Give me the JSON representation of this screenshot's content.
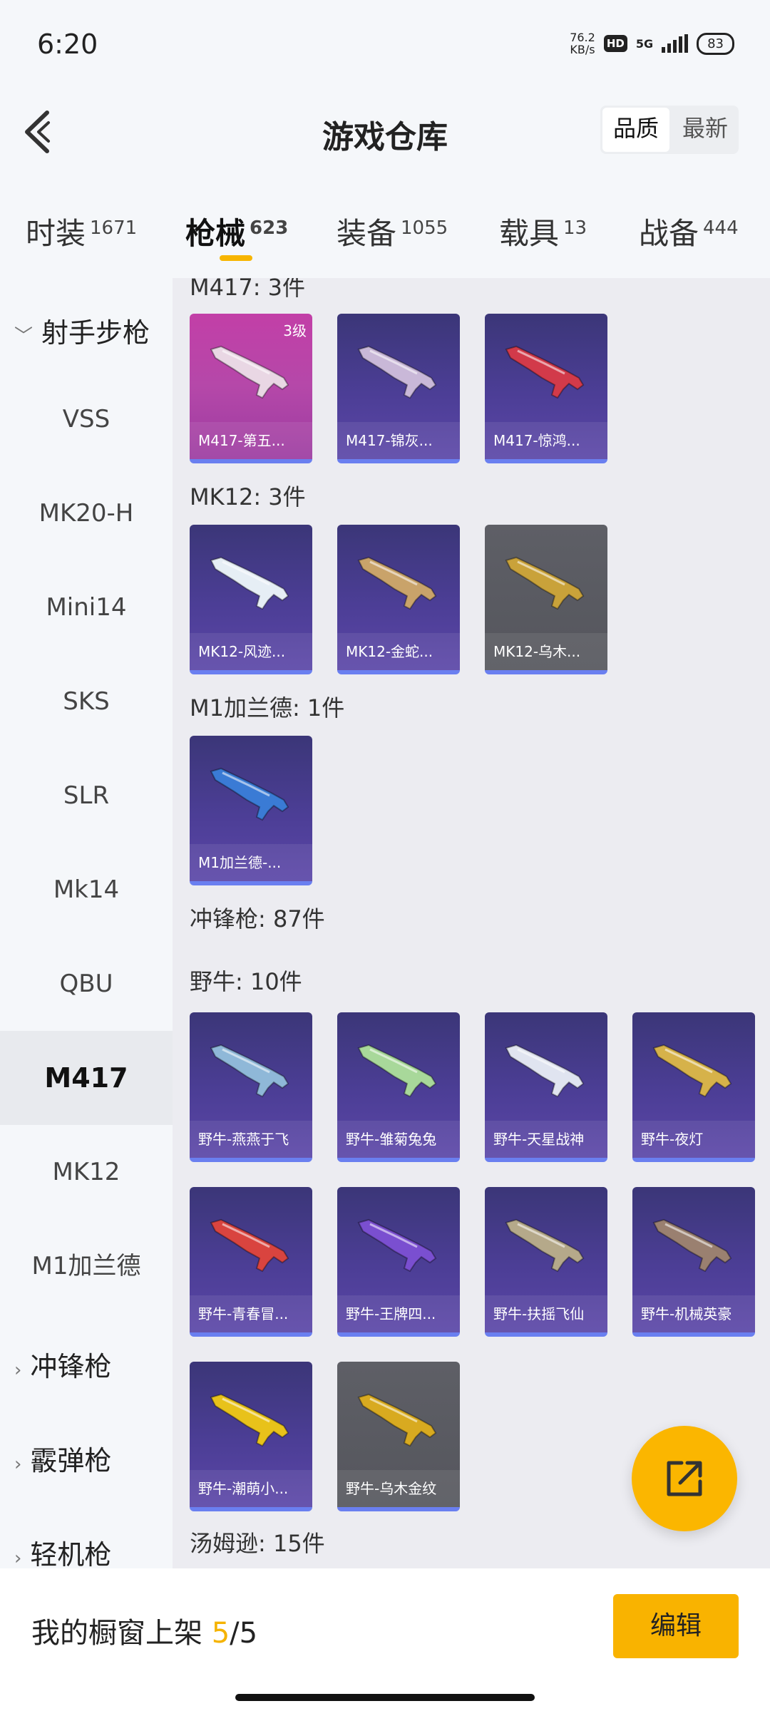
{
  "status": {
    "time": "6:20",
    "speed": "76.2",
    "speed_unit": "KB/s",
    "hd": "HD",
    "network": "5G",
    "battery": "83"
  },
  "header": {
    "title": "游戏仓库",
    "toggle": [
      "品质",
      "最新"
    ]
  },
  "tabs": [
    {
      "label": "时装",
      "count": "1671"
    },
    {
      "label": "枪械",
      "count": "623"
    },
    {
      "label": "装备",
      "count": "1055"
    },
    {
      "label": "载具",
      "count": "13"
    },
    {
      "label": "战备",
      "count": "444"
    }
  ],
  "sidebar": {
    "category_open": "射手步枪",
    "items": [
      "VSS",
      "MK20-H",
      "Mini14",
      "SKS",
      "SLR",
      "Mk14",
      "QBU",
      "M417",
      "MK12",
      "M1加兰德"
    ],
    "selected": "M417",
    "categories_closed": [
      "冲锋枪",
      "霰弹枪",
      "轻机枪"
    ]
  },
  "content": {
    "sections": [
      {
        "title": "M417: 3件",
        "cards": [
          {
            "name": "M417-第五...",
            "level": "3级",
            "style": "pink",
            "accent": "#e9d7e4"
          },
          {
            "name": "M417-锦灰...",
            "style": "purple",
            "accent": "#c9b8d8"
          },
          {
            "name": "M417-惊鸿...",
            "style": "purple",
            "accent": "#d23a4a"
          }
        ]
      },
      {
        "title": "MK12: 3件",
        "cards": [
          {
            "name": "MK12-风迹...",
            "style": "purple",
            "accent": "#e6eef5"
          },
          {
            "name": "MK12-金蛇...",
            "style": "purple",
            "accent": "#c9a36a"
          },
          {
            "name": "MK12-乌木...",
            "style": "gray",
            "accent": "#c9a23a"
          }
        ]
      },
      {
        "title": "M1加兰德: 1件",
        "cards": [
          {
            "name": "M1加兰德-...",
            "style": "purple",
            "accent": "#3a7bd5"
          }
        ]
      },
      {
        "title": "冲锋枪: 87件",
        "cards": []
      },
      {
        "title": "野牛: 10件",
        "cards": [
          {
            "name": "野牛-燕燕于飞",
            "style": "purple",
            "accent": "#8fb8d8"
          },
          {
            "name": "野牛-雏菊兔兔",
            "style": "purple",
            "accent": "#a8d89a"
          },
          {
            "name": "野牛-天星战神",
            "style": "purple",
            "accent": "#e0e4f0"
          },
          {
            "name": "野牛-夜灯",
            "style": "purple",
            "accent": "#d6b24a"
          },
          {
            "name": "野牛-青春冒...",
            "style": "purple",
            "accent": "#d9443f"
          },
          {
            "name": "野牛-王牌四...",
            "style": "purple",
            "accent": "#7a4fd0"
          },
          {
            "name": "野牛-扶摇飞仙",
            "style": "purple",
            "accent": "#b5a98a"
          },
          {
            "name": "野牛-机械英豪",
            "style": "purple",
            "accent": "#9a8070"
          },
          {
            "name": "野牛-潮萌小...",
            "style": "purple",
            "accent": "#e8c21a"
          },
          {
            "name": "野牛-乌木金纹",
            "style": "gray",
            "accent": "#d8aa20"
          }
        ]
      },
      {
        "title": "汤姆逊: 15件",
        "cards": []
      }
    ]
  },
  "bottom": {
    "label": "我的橱窗上架",
    "current": "5",
    "total": "/5",
    "edit": "编辑"
  },
  "colors": {
    "accent": "#f9b300",
    "card_purple": "#4c3e96",
    "card_pink": "#c23fa7",
    "card_gray": "#5e5f66"
  }
}
